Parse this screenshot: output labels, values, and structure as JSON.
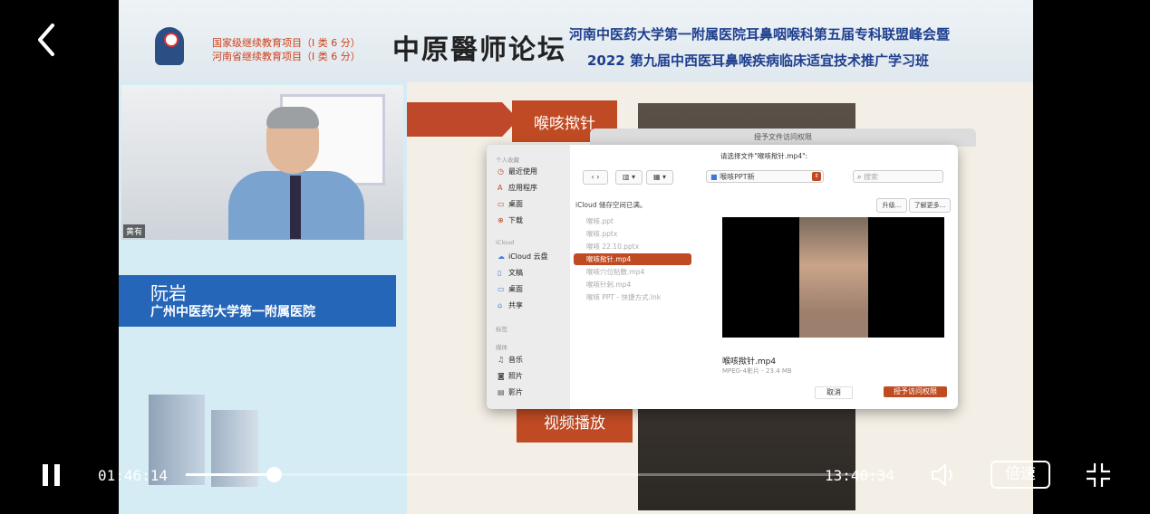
{
  "player": {
    "current_time": "01:46:14",
    "duration": "13:40:34",
    "progress": 0.125,
    "speed_label": "倍速"
  },
  "banner": {
    "project_line1": "国家级继续教育项目（I 类 6 分）",
    "project_line2": "河南省继续教育项目（I 类 6 分）",
    "forum_title": "中原醫师论坛",
    "conference_line1": "河南中医药大学第一附属医院耳鼻咽喉科第五届专科联盟峰会暨",
    "conference_line2": "2022 第九届中西医耳鼻喉疾病临床适宜技术推广学习班"
  },
  "speaker": {
    "camera_label": "黄有",
    "name": "阮岩",
    "affiliation": "广州中医药大学第一附属医院"
  },
  "slide": {
    "top_button": "喉咳揿针",
    "bottom_button": "视频播放",
    "dialog": {
      "title_bar": "授予文件访问权限",
      "prompt": "请选择文件\"喉咳揿针.mp4\":",
      "folder": "喉咳PPT新",
      "search_placeholder": "搜索",
      "icloud_notice": "iCloud 储存空间已满。",
      "upgrade_button": "升级...",
      "learn_more_button": "了解更多...",
      "sidebar": {
        "personal_header": "个人收藏",
        "personal_items": [
          "最近使用",
          "应用程序",
          "桌面",
          "下载"
        ],
        "icloud_header": "iCloud",
        "icloud_items": [
          "iCloud 云盘",
          "文稿",
          "桌面",
          "共享"
        ],
        "tags_header": "标签",
        "media_header": "媒体",
        "media_items": [
          "音乐",
          "照片",
          "影片"
        ]
      },
      "files": [
        "喉咳.ppt",
        "喉咳.pptx",
        "喉咳 22.10.pptx",
        "喉咳揿针.mp4",
        "喉咳穴位贴敷.mp4",
        "喉咳针刺.mp4",
        "喉咳 PPT - 快捷方式.lnk"
      ],
      "selected_file_index": 3,
      "preview_name": "喉咳揿针.mp4",
      "preview_info": "MPEG-4影片 - 23.4 MB",
      "cancel_button": "取消",
      "grant_button": "授予访问权限"
    }
  }
}
